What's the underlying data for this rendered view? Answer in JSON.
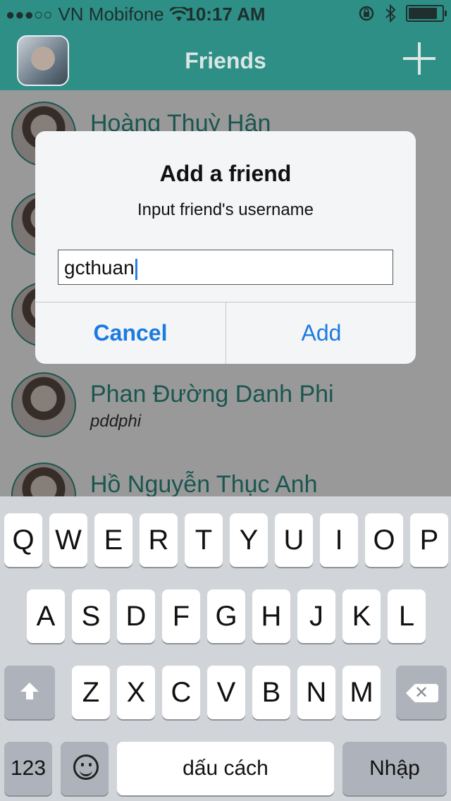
{
  "status_bar": {
    "signal_dots": "●●●○○",
    "carrier": "VN Mobifone",
    "time": "10:17 AM",
    "icons": [
      "wifi-icon",
      "rotation-lock-icon",
      "bluetooth-icon",
      "battery-icon"
    ],
    "battery_level": 0.92
  },
  "nav": {
    "title": "Friends",
    "add_icon": "plus-icon"
  },
  "friends": [
    {
      "name": "Hoàng Thuỳ Hân",
      "username": ""
    },
    {
      "name": "",
      "username": ""
    },
    {
      "name": "",
      "username": ""
    },
    {
      "name": "Phan Đường Danh Phi",
      "username": "pddphi"
    },
    {
      "name": "Hồ Nguyễn Thục Anh",
      "username": ""
    }
  ],
  "dialog": {
    "title": "Add a friend",
    "message": "Input friend's username",
    "input_value": "gcthuan",
    "cancel_label": "Cancel",
    "add_label": "Add"
  },
  "keyboard": {
    "row1": [
      "Q",
      "W",
      "E",
      "R",
      "T",
      "Y",
      "U",
      "I",
      "O",
      "P"
    ],
    "row2": [
      "A",
      "S",
      "D",
      "F",
      "G",
      "H",
      "J",
      "K",
      "L"
    ],
    "row3": [
      "Z",
      "X",
      "C",
      "V",
      "B",
      "N",
      "M"
    ],
    "numbers_label": "123",
    "space_label": "dấu cách",
    "return_label": "Nhập"
  },
  "colors": {
    "accent": "#2e8f86",
    "link_blue": "#1c7be0",
    "keyboard_bg": "#d1d4d9"
  }
}
